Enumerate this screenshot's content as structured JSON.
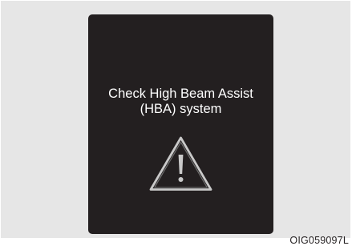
{
  "warning": {
    "line1": "Check High Beam Assist",
    "line2": "(HBA) system",
    "icon": "warning-triangle-icon"
  },
  "figure_code": "OIG059097L",
  "colors": {
    "display_background": "#231f20",
    "frame_background": "#e6e6e6",
    "text": "#ffffff",
    "icon_stroke": "#bdbdbd"
  }
}
